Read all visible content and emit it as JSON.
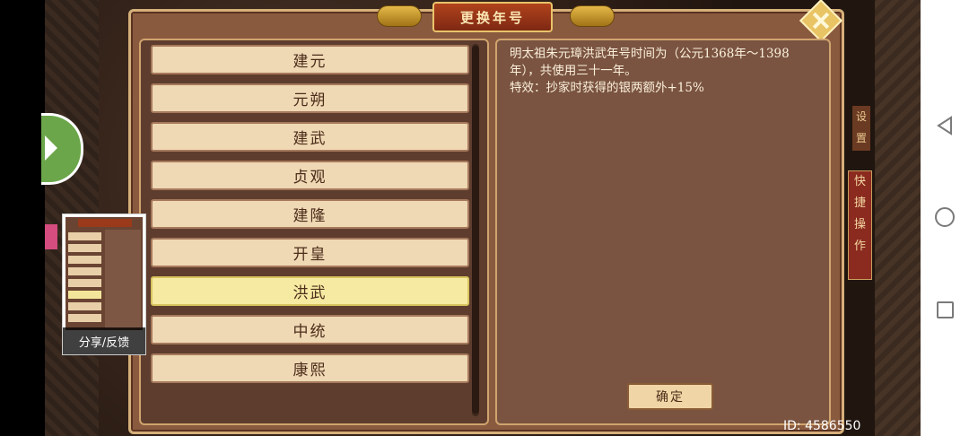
{
  "dialog": {
    "title": "更换年号",
    "confirm_label": "确定"
  },
  "era_list": [
    {
      "label": "建元",
      "selected": false
    },
    {
      "label": "元朔",
      "selected": false
    },
    {
      "label": "建武",
      "selected": false
    },
    {
      "label": "贞观",
      "selected": false
    },
    {
      "label": "建隆",
      "selected": false
    },
    {
      "label": "开皇",
      "selected": false
    },
    {
      "label": "洪武",
      "selected": true
    },
    {
      "label": "中统",
      "selected": false
    },
    {
      "label": "康熙",
      "selected": false
    }
  ],
  "description": {
    "line1": "明太祖朱元璋洪武年号时间为（公元1368年～1398年），共使用三十一年。",
    "line2": "特效：抄家时获得的银两额外+15%"
  },
  "side_buttons": {
    "setting": "设置",
    "quick_ops": [
      "快",
      "捷",
      "操",
      "作"
    ]
  },
  "share_widget": {
    "label": "分享/反馈"
  },
  "id_text": "ID: 4586550",
  "icons": {
    "nav_back": "triangle-back-icon",
    "nav_home": "circle-home-icon",
    "nav_recent": "square-recent-icon",
    "close": "close-icon"
  },
  "colors": {
    "selected_item": "#f6eaa2",
    "item": "#efd8b4",
    "title_plaque": "#9a3518"
  }
}
